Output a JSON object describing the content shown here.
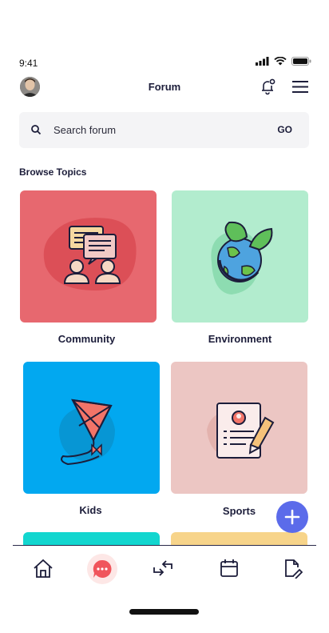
{
  "status": {
    "time": "9:41"
  },
  "header": {
    "title": "Forum",
    "icons": [
      "avatar",
      "bell-icon",
      "menu-icon"
    ]
  },
  "search": {
    "placeholder": "Search forum",
    "go_label": "GO"
  },
  "section_title": "Browse Topics",
  "topics": [
    {
      "label": "Community",
      "color": "#e7686f",
      "icon": "community-icon"
    },
    {
      "label": "Environment",
      "color": "#b2ecce",
      "icon": "globe-leaves-icon"
    },
    {
      "label": "Kids",
      "color": "#02a8f0",
      "icon": "kite-icon"
    },
    {
      "label": "Sports",
      "color": "#ecc6c3",
      "icon": "document-pen-icon"
    }
  ],
  "partial_cards": [
    {
      "color": "#12d6cf"
    },
    {
      "color": "#f7d48a"
    }
  ],
  "nav": {
    "items": [
      "home-icon",
      "chat-icon",
      "swap-icon",
      "calendar-icon",
      "document-edit-icon"
    ],
    "active": "chat-icon"
  },
  "colors": {
    "accent": "#5b6bea",
    "text": "#1c1d3a"
  }
}
